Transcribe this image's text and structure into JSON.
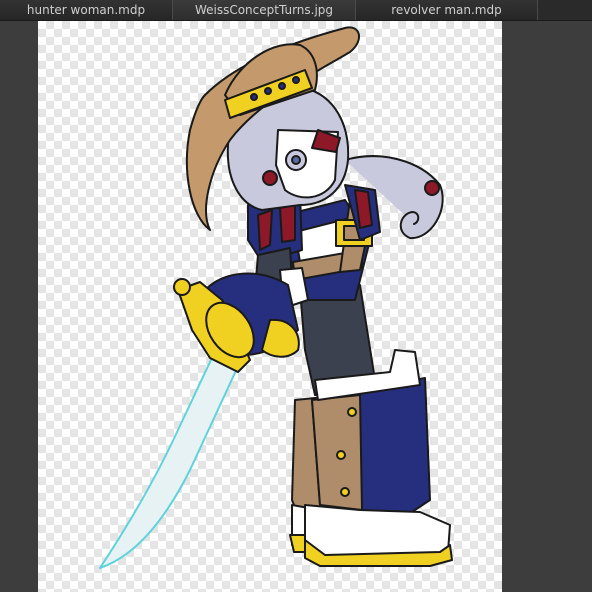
{
  "tabs": [
    {
      "label": "hunter woman.mdp"
    },
    {
      "label": "WeissConceptTurns.jpg"
    },
    {
      "label": "revolver man.mdp"
    }
  ],
  "canvas": {
    "transparency": "checkerboard",
    "artwork": "character-illustration"
  },
  "colors": {
    "app_background": "#3d3d3d",
    "tab_bar": "#2a2a2a",
    "hat": "#c49a6c",
    "hat_band": "#f0d020",
    "hair": "#c9c9dd",
    "armor_blue": "#262f7e",
    "sleeve_red": "#8c1828",
    "gold": "#f0d020",
    "boot_brown": "#b08d6a",
    "sword": "#e6f2f3",
    "sword_edge": "#5fd3dc",
    "leggings": "#3c4150"
  }
}
